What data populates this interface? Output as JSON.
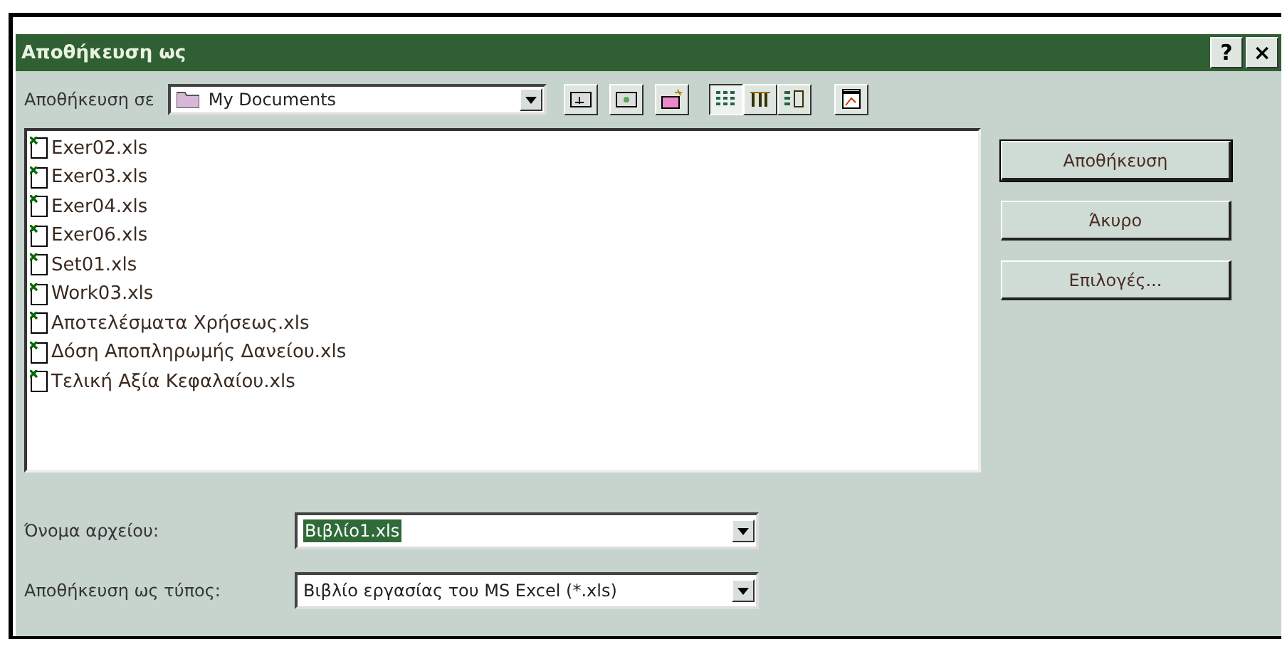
{
  "window": {
    "title": "Αποθήκευση ως",
    "title_buttons": [
      "?",
      "×"
    ]
  },
  "save_in": {
    "label": "Αποθήκευση σε",
    "value": "My Documents"
  },
  "view_buttons": [
    {
      "selected": true
    },
    {
      "selected": false
    },
    {
      "selected": false
    }
  ],
  "files": [
    {
      "name": "Exer02.xls"
    },
    {
      "name": "Exer03.xls"
    },
    {
      "name": "Exer04.xls"
    },
    {
      "name": "Exer06.xls"
    },
    {
      "name": "Set01.xls"
    },
    {
      "name": "Work03.xls"
    },
    {
      "name": "Αποτελέσματα Χρήσεως.xls"
    },
    {
      "name": "Δόση Αποπληρωμής Δανείου.xls"
    },
    {
      "name": "Τελική Αξία Κεφαλαίου.xls"
    }
  ],
  "buttons": [
    {
      "label": "Αποθήκευση",
      "default": true
    },
    {
      "label": "Άκυρο",
      "default": false
    },
    {
      "label": "Επιλογές...",
      "default": false
    }
  ],
  "file_name": {
    "label": "Όνομα αρχείου:",
    "value": "Βιβλίο1.xls",
    "selected": true
  },
  "save_as_type": {
    "label": "Αποθήκευση ως τύπος:",
    "value": "Βιβλίο εργασίας του MS Excel (*.xls)"
  }
}
